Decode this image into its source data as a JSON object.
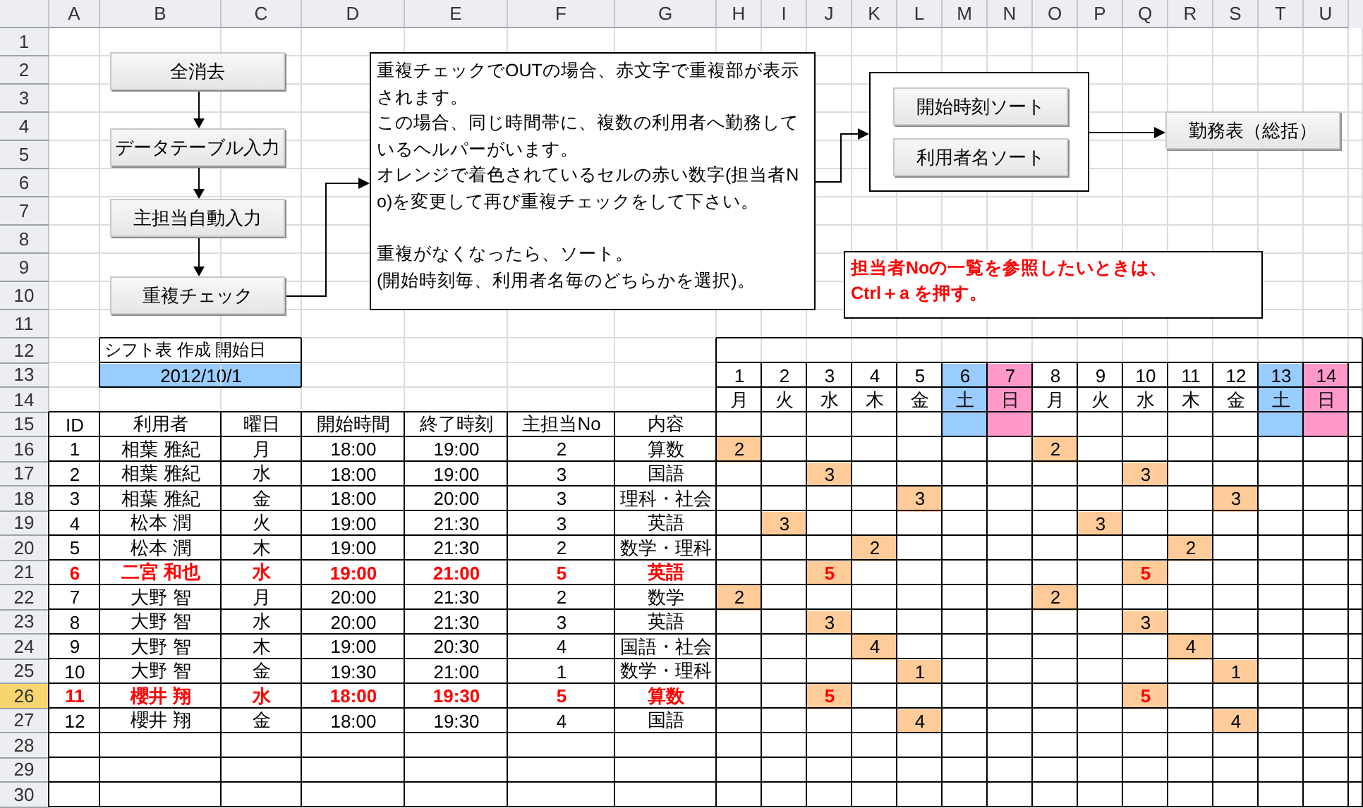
{
  "column_headers": [
    "A",
    "B",
    "C",
    "D",
    "E",
    "F",
    "G",
    "H",
    "I",
    "J",
    "K",
    "L",
    "M",
    "N",
    "O",
    "P",
    "Q",
    "R",
    "S",
    "T",
    "U"
  ],
  "row_numbers": [
    {
      "label": "1",
      "selected": false
    },
    {
      "label": "2",
      "selected": false
    },
    {
      "label": "3",
      "selected": false
    },
    {
      "label": "4",
      "selected": false
    },
    {
      "label": "5",
      "selected": false
    },
    {
      "label": "6",
      "selected": false
    },
    {
      "label": "7",
      "selected": false
    },
    {
      "label": "8",
      "selected": false
    },
    {
      "label": "9",
      "selected": false
    },
    {
      "label": "10",
      "selected": false
    },
    {
      "label": "11",
      "selected": false
    },
    {
      "label": "12",
      "selected": false
    },
    {
      "label": "13",
      "selected": false
    },
    {
      "label": "14",
      "selected": false
    },
    {
      "label": "15",
      "selected": false
    },
    {
      "label": "16",
      "selected": false
    },
    {
      "label": "17",
      "selected": false
    },
    {
      "label": "18",
      "selected": false
    },
    {
      "label": "19",
      "selected": false
    },
    {
      "label": "20",
      "selected": false
    },
    {
      "label": "21",
      "selected": false
    },
    {
      "label": "22",
      "selected": false
    },
    {
      "label": "23",
      "selected": false
    },
    {
      "label": "24",
      "selected": false
    },
    {
      "label": "25",
      "selected": false
    },
    {
      "label": "26",
      "selected": true
    },
    {
      "label": "27",
      "selected": false
    },
    {
      "label": "28",
      "selected": false
    },
    {
      "label": "29",
      "selected": false
    },
    {
      "label": "30",
      "selected": false
    }
  ],
  "flow_buttons": [
    "全消去",
    "データテーブル入力",
    "主担当自動入力",
    "重複チェック"
  ],
  "instructions": [
    {
      "paragraphs": [
        "重複チェックでOUTの場合、赤文字で重複部が表示されます。",
        "この場合、同じ時間帯に、複数の利用者へ勤務しているヘルパーがいます。",
        "オレンジで着色されているセルの赤い数字(担当者No)を変更して再び重複チェックをして下さい。"
      ]
    },
    {
      "paragraphs": [
        "重複がなくなったら、ソート。",
        "(開始時刻毎、利用者名毎のどちらかを選択)。"
      ]
    }
  ],
  "sort_buttons": [
    "開始時刻ソート",
    "利用者名ソート"
  ],
  "summary_button": "勤務表（総括）",
  "hint": [
    "担当者Noの一覧を参照したいときは、",
    "Ctrl＋a を押す。"
  ],
  "start_date": {
    "label": "シフト表 作成 開始日",
    "value": "2012/10/1"
  },
  "calendar": [
    {
      "date": "1",
      "weekday": "月",
      "kind": "weekday"
    },
    {
      "date": "2",
      "weekday": "火",
      "kind": "weekday"
    },
    {
      "date": "3",
      "weekday": "水",
      "kind": "weekday"
    },
    {
      "date": "4",
      "weekday": "木",
      "kind": "weekday"
    },
    {
      "date": "5",
      "weekday": "金",
      "kind": "weekday"
    },
    {
      "date": "6",
      "weekday": "土",
      "kind": "saturday"
    },
    {
      "date": "7",
      "weekday": "日",
      "kind": "sunday"
    },
    {
      "date": "8",
      "weekday": "月",
      "kind": "weekday"
    },
    {
      "date": "9",
      "weekday": "火",
      "kind": "weekday"
    },
    {
      "date": "10",
      "weekday": "水",
      "kind": "weekday"
    },
    {
      "date": "11",
      "weekday": "木",
      "kind": "weekday"
    },
    {
      "date": "12",
      "weekday": "金",
      "kind": "weekday"
    },
    {
      "date": "13",
      "weekday": "土",
      "kind": "saturday"
    },
    {
      "date": "14",
      "weekday": "日",
      "kind": "sunday"
    }
  ],
  "table": {
    "columns": [
      "ID",
      "利用者",
      "曜日",
      "開始時間",
      "終了時刻",
      "主担当No",
      "内容"
    ],
    "rows": [
      {
        "id": "1",
        "user": "相葉 雅紀",
        "weekday": "月",
        "start": "18:00",
        "end": "19:00",
        "staff_no": "2",
        "subject": "算数",
        "duplicate": false,
        "shifts": [
          {
            "assigned": true,
            "value": "2"
          },
          {
            "assigned": false
          },
          {
            "assigned": false
          },
          {
            "assigned": false
          },
          {
            "assigned": false
          },
          {
            "assigned": false
          },
          {
            "assigned": false
          },
          {
            "assigned": true,
            "value": "2"
          },
          {
            "assigned": false
          },
          {
            "assigned": false
          },
          {
            "assigned": false
          },
          {
            "assigned": false
          },
          {
            "assigned": false
          },
          {
            "assigned": false
          }
        ]
      },
      {
        "id": "2",
        "user": "相葉 雅紀",
        "weekday": "水",
        "start": "18:00",
        "end": "19:00",
        "staff_no": "3",
        "subject": "国語",
        "duplicate": false,
        "shifts": [
          {
            "assigned": false
          },
          {
            "assigned": false
          },
          {
            "assigned": true,
            "value": "3"
          },
          {
            "assigned": false
          },
          {
            "assigned": false
          },
          {
            "assigned": false
          },
          {
            "assigned": false
          },
          {
            "assigned": false
          },
          {
            "assigned": false
          },
          {
            "assigned": true,
            "value": "3"
          },
          {
            "assigned": false
          },
          {
            "assigned": false
          },
          {
            "assigned": false
          },
          {
            "assigned": false
          }
        ]
      },
      {
        "id": "3",
        "user": "相葉 雅紀",
        "weekday": "金",
        "start": "18:00",
        "end": "20:00",
        "staff_no": "3",
        "subject": "理科・社会",
        "duplicate": false,
        "shifts": [
          {
            "assigned": false
          },
          {
            "assigned": false
          },
          {
            "assigned": false
          },
          {
            "assigned": false
          },
          {
            "assigned": true,
            "value": "3"
          },
          {
            "assigned": false
          },
          {
            "assigned": false
          },
          {
            "assigned": false
          },
          {
            "assigned": false
          },
          {
            "assigned": false
          },
          {
            "assigned": false
          },
          {
            "assigned": true,
            "value": "3"
          },
          {
            "assigned": false
          },
          {
            "assigned": false
          }
        ]
      },
      {
        "id": "4",
        "user": "松本 潤",
        "weekday": "火",
        "start": "19:00",
        "end": "21:30",
        "staff_no": "3",
        "subject": "英語",
        "duplicate": false,
        "shifts": [
          {
            "assigned": false
          },
          {
            "assigned": true,
            "value": "3"
          },
          {
            "assigned": false
          },
          {
            "assigned": false
          },
          {
            "assigned": false
          },
          {
            "assigned": false
          },
          {
            "assigned": false
          },
          {
            "assigned": false
          },
          {
            "assigned": true,
            "value": "3"
          },
          {
            "assigned": false
          },
          {
            "assigned": false
          },
          {
            "assigned": false
          },
          {
            "assigned": false
          },
          {
            "assigned": false
          }
        ]
      },
      {
        "id": "5",
        "user": "松本 潤",
        "weekday": "木",
        "start": "19:00",
        "end": "21:30",
        "staff_no": "2",
        "subject": "数学・理科",
        "duplicate": false,
        "shifts": [
          {
            "assigned": false
          },
          {
            "assigned": false
          },
          {
            "assigned": false
          },
          {
            "assigned": true,
            "value": "2"
          },
          {
            "assigned": false
          },
          {
            "assigned": false
          },
          {
            "assigned": false
          },
          {
            "assigned": false
          },
          {
            "assigned": false
          },
          {
            "assigned": false
          },
          {
            "assigned": true,
            "value": "2"
          },
          {
            "assigned": false
          },
          {
            "assigned": false
          },
          {
            "assigned": false
          }
        ]
      },
      {
        "id": "6",
        "user": "二宮 和也",
        "weekday": "水",
        "start": "19:00",
        "end": "21:00",
        "staff_no": "5",
        "subject": "英語",
        "duplicate": true,
        "shifts": [
          {
            "assigned": false
          },
          {
            "assigned": false
          },
          {
            "assigned": true,
            "value": "5"
          },
          {
            "assigned": false
          },
          {
            "assigned": false
          },
          {
            "assigned": false
          },
          {
            "assigned": false
          },
          {
            "assigned": false
          },
          {
            "assigned": false
          },
          {
            "assigned": true,
            "value": "5"
          },
          {
            "assigned": false
          },
          {
            "assigned": false
          },
          {
            "assigned": false
          },
          {
            "assigned": false
          }
        ]
      },
      {
        "id": "7",
        "user": "大野 智",
        "weekday": "月",
        "start": "20:00",
        "end": "21:30",
        "staff_no": "2",
        "subject": "数学",
        "duplicate": false,
        "shifts": [
          {
            "assigned": true,
            "value": "2"
          },
          {
            "assigned": false
          },
          {
            "assigned": false
          },
          {
            "assigned": false
          },
          {
            "assigned": false
          },
          {
            "assigned": false
          },
          {
            "assigned": false
          },
          {
            "assigned": true,
            "value": "2"
          },
          {
            "assigned": false
          },
          {
            "assigned": false
          },
          {
            "assigned": false
          },
          {
            "assigned": false
          },
          {
            "assigned": false
          },
          {
            "assigned": false
          }
        ]
      },
      {
        "id": "8",
        "user": "大野 智",
        "weekday": "水",
        "start": "20:00",
        "end": "21:30",
        "staff_no": "3",
        "subject": "英語",
        "duplicate": false,
        "shifts": [
          {
            "assigned": false
          },
          {
            "assigned": false
          },
          {
            "assigned": true,
            "value": "3"
          },
          {
            "assigned": false
          },
          {
            "assigned": false
          },
          {
            "assigned": false
          },
          {
            "assigned": false
          },
          {
            "assigned": false
          },
          {
            "assigned": false
          },
          {
            "assigned": true,
            "value": "3"
          },
          {
            "assigned": false
          },
          {
            "assigned": false
          },
          {
            "assigned": false
          },
          {
            "assigned": false
          }
        ]
      },
      {
        "id": "9",
        "user": "大野 智",
        "weekday": "木",
        "start": "19:00",
        "end": "20:30",
        "staff_no": "4",
        "subject": "国語・社会",
        "duplicate": false,
        "shifts": [
          {
            "assigned": false
          },
          {
            "assigned": false
          },
          {
            "assigned": false
          },
          {
            "assigned": true,
            "value": "4"
          },
          {
            "assigned": false
          },
          {
            "assigned": false
          },
          {
            "assigned": false
          },
          {
            "assigned": false
          },
          {
            "assigned": false
          },
          {
            "assigned": false
          },
          {
            "assigned": true,
            "value": "4"
          },
          {
            "assigned": false
          },
          {
            "assigned": false
          },
          {
            "assigned": false
          }
        ]
      },
      {
        "id": "10",
        "user": "大野 智",
        "weekday": "金",
        "start": "19:30",
        "end": "21:00",
        "staff_no": "1",
        "subject": "数学・理科",
        "duplicate": false,
        "shifts": [
          {
            "assigned": false
          },
          {
            "assigned": false
          },
          {
            "assigned": false
          },
          {
            "assigned": false
          },
          {
            "assigned": true,
            "value": "1"
          },
          {
            "assigned": false
          },
          {
            "assigned": false
          },
          {
            "assigned": false
          },
          {
            "assigned": false
          },
          {
            "assigned": false
          },
          {
            "assigned": false
          },
          {
            "assigned": true,
            "value": "1"
          },
          {
            "assigned": false
          },
          {
            "assigned": false
          }
        ]
      },
      {
        "id": "11",
        "user": "櫻井 翔",
        "weekday": "水",
        "start": "18:00",
        "end": "19:30",
        "staff_no": "5",
        "subject": "算数",
        "duplicate": true,
        "shifts": [
          {
            "assigned": false
          },
          {
            "assigned": false
          },
          {
            "assigned": true,
            "value": "5"
          },
          {
            "assigned": false
          },
          {
            "assigned": false
          },
          {
            "assigned": false
          },
          {
            "assigned": false
          },
          {
            "assigned": false
          },
          {
            "assigned": false
          },
          {
            "assigned": true,
            "value": "5"
          },
          {
            "assigned": false
          },
          {
            "assigned": false
          },
          {
            "assigned": false
          },
          {
            "assigned": false
          }
        ]
      },
      {
        "id": "12",
        "user": "櫻井 翔",
        "weekday": "金",
        "start": "18:00",
        "end": "19:30",
        "staff_no": "4",
        "subject": "国語",
        "duplicate": false,
        "shifts": [
          {
            "assigned": false
          },
          {
            "assigned": false
          },
          {
            "assigned": false
          },
          {
            "assigned": false
          },
          {
            "assigned": true,
            "value": "4"
          },
          {
            "assigned": false
          },
          {
            "assigned": false
          },
          {
            "assigned": false
          },
          {
            "assigned": false
          },
          {
            "assigned": false
          },
          {
            "assigned": false
          },
          {
            "assigned": true,
            "value": "4"
          },
          {
            "assigned": false
          },
          {
            "assigned": false
          }
        ]
      }
    ]
  }
}
